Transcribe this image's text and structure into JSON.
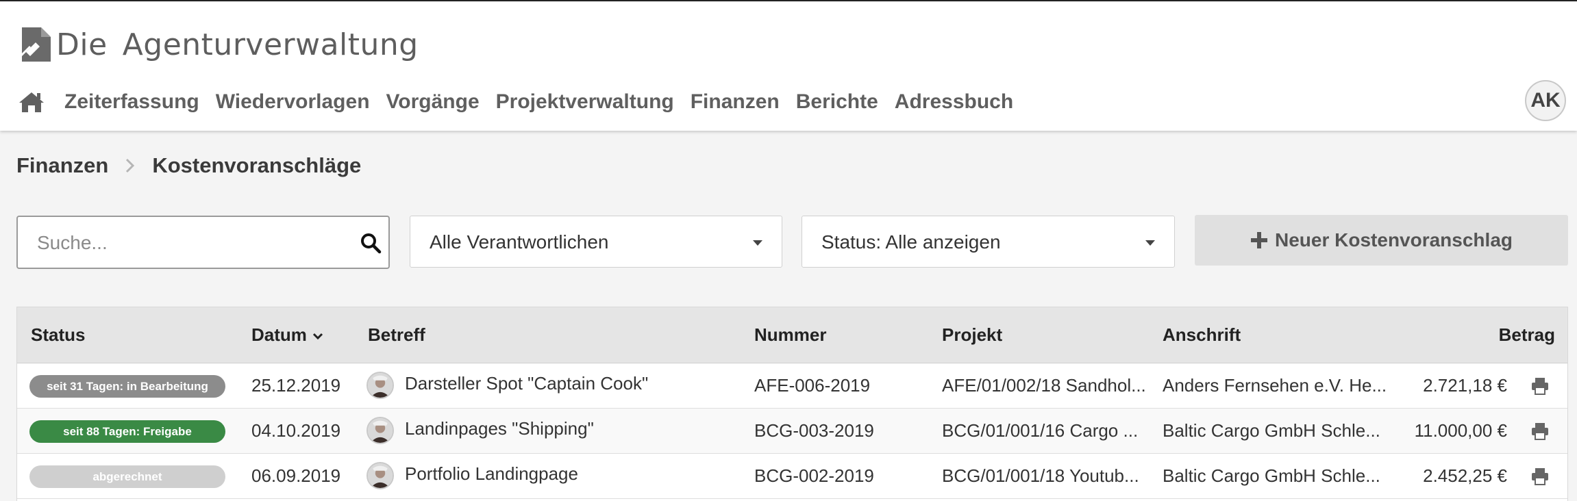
{
  "app": {
    "logo_word1": "Die",
    "logo_word2": "Agenturverwaltung",
    "user_initials": "AK"
  },
  "nav": {
    "home_icon": "home-icon",
    "items": [
      "Zeiterfassung",
      "Wiedervorlagen",
      "Vorgänge",
      "Projektverwaltung",
      "Finanzen",
      "Berichte",
      "Adressbuch"
    ]
  },
  "breadcrumb": {
    "parent": "Finanzen",
    "current": "Kostenvoranschläge"
  },
  "filters": {
    "search_placeholder": "Suche...",
    "search_value": "",
    "responsible": "Alle Verantwortlichen",
    "status": "Status: Alle anzeigen",
    "new_button": "Neuer Kostenvoranschlag"
  },
  "table": {
    "headers": {
      "status": "Status",
      "date": "Datum",
      "subject": "Betreff",
      "number": "Nummer",
      "project": "Projekt",
      "address": "Anschrift",
      "amount": "Betrag"
    },
    "sort": {
      "column": "Datum",
      "direction": "descending"
    },
    "rows": [
      {
        "status": "seit 31 Tagen: in Bearbeitung",
        "status_color": "#8c8c8c",
        "date": "25.12.2019",
        "subject": "Darsteller Spot \"Captain Cook\"",
        "number": "AFE-006-2019",
        "project": "AFE/01/002/18 Sandhol...",
        "address": "Anders Fernsehen e.V. He...",
        "amount": "2.721,18 €"
      },
      {
        "status": "seit 88 Tagen: Freigabe",
        "status_color": "#3a8a45",
        "date": "04.10.2019",
        "subject": "Landinpages \"Shipping\"",
        "number": "BCG-003-2019",
        "project": "BCG/01/001/16 Cargo ...",
        "address": "Baltic Cargo GmbH Schle...",
        "amount": "11.000,00 €"
      },
      {
        "status": "abgerechnet",
        "status_color": "#cfcfcf",
        "date": "06.09.2019",
        "subject": "Portfolio Landingpage",
        "number": "BCG-002-2019",
        "project": "BCG/01/001/18 Youtub...",
        "address": "Baltic Cargo GmbH Schle...",
        "amount": "2.452,25 €"
      }
    ]
  },
  "colors": {
    "in_progress": "#8c8c8c",
    "approved": "#3a8a45",
    "billed": "#cfcfcf"
  }
}
